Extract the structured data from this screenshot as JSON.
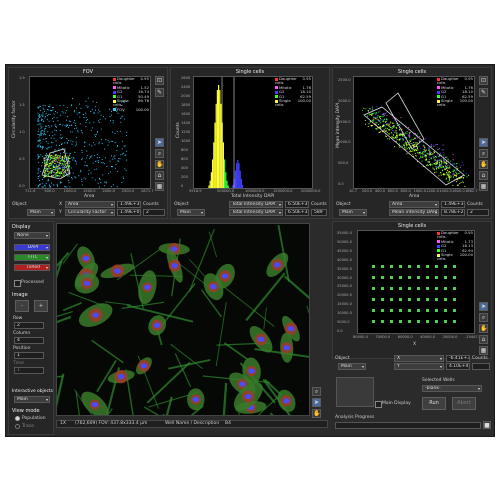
{
  "plots": {
    "fov": {
      "title": "FOV",
      "xlabel": "Area",
      "ylabel": "Circularity factor",
      "xticks": [
        "711.4",
        "500.0",
        "1000.0",
        "1500.0",
        "2000.0",
        "2500.0",
        "2871.7"
      ],
      "yticks": [
        "1.9",
        "1.5",
        "1.0",
        "0.5",
        "0.0"
      ],
      "legend": [
        {
          "name": "Daughter cells",
          "value": "0.95",
          "color": "#ff3030"
        },
        {
          "name": "Mitotic",
          "value": "1.52",
          "color": "#ff55ff"
        },
        {
          "name": "G2",
          "value": "16.74",
          "color": "#3f3fff"
        },
        {
          "name": "G1",
          "value": "50.49",
          "color": "#30ff30"
        },
        {
          "name": "Single cells",
          "value": "89.76",
          "color": "#ffff30"
        },
        {
          "name": "FOV",
          "value": "100.00",
          "color": "#30d0ff"
        }
      ],
      "x_box_label": "X",
      "y_box_label": "Y",
      "x_param": "Area",
      "y_param": "Circularity Factor",
      "x_val": "1.49E+3",
      "y_val": "1.49E+0",
      "counts_label": "Counts",
      "counts": "2",
      "object_label": "Object",
      "object": "Main"
    },
    "hist": {
      "title": "Single cells",
      "xlabel": "Total Intensity DAPI",
      "ylabel": "Counts",
      "xticks": [
        "5918.9",
        "500000.0",
        "1000000.0",
        "1500000.0",
        "2000000.0"
      ],
      "yticks": [
        "2600",
        "2400",
        "2000",
        "1800",
        "1600",
        "1400",
        "1200",
        "1000",
        "800",
        "600",
        "400",
        "200",
        "0"
      ],
      "legend": [
        {
          "name": "Daughter cells",
          "value": "0.95",
          "color": "#ff3030"
        },
        {
          "name": "Mitotic",
          "value": "1.76",
          "color": "#ff55ff"
        },
        {
          "name": "G2",
          "value": "18.10",
          "color": "#3f3fff"
        },
        {
          "name": "G1",
          "value": "62.59",
          "color": "#30ff30"
        },
        {
          "name": "Single cells",
          "value": "100.00",
          "color": "#ffff30"
        }
      ],
      "x_param": "Total Intensity DAPI",
      "y_param": "Total Intensity DAPI",
      "x_val": "6.50E+3",
      "y_val": "6.50E+3",
      "counts_label": "Counts",
      "counts": "589",
      "object": "Main"
    },
    "scatter2": {
      "title": "Single cells",
      "xlabel": "Area",
      "ylabel": "Mean intensity DAPI",
      "xticks": [
        "10.7",
        "200.0",
        "400.0",
        "600.0",
        "800.0",
        "1000.0",
        "1200.0",
        "1400.0",
        "1600.0",
        "1862.7"
      ],
      "yticks": [
        "2500.0",
        "2000.0",
        "1500.0",
        "1000.0",
        "500.0",
        "0.0"
      ],
      "legend": [
        {
          "name": "Daughter cells",
          "value": "0.95",
          "color": "#ff3030"
        },
        {
          "name": "Mitotic",
          "value": "1.76",
          "color": "#ff55ff"
        },
        {
          "name": "G2",
          "value": "18.10",
          "color": "#3f3fff"
        },
        {
          "name": "G1",
          "value": "62.59",
          "color": "#30ff30"
        },
        {
          "name": "Single cells",
          "value": "100.00",
          "color": "#ffff30"
        }
      ],
      "x_param": "Area",
      "y_param": "Mean intensity DAPI",
      "x_val": "1.49E+3",
      "y_val": "8.78E+2",
      "counts_label": "Counts",
      "counts": "2",
      "object": "Main"
    },
    "plate": {
      "title": "Single cells",
      "xlabel": "X",
      "yticks": [
        "55000.0",
        "50000.0",
        "45000.0",
        "40000.0",
        "35000.0",
        "30000.0",
        "25000.0",
        "20000.0",
        "15000.0",
        "10000.0",
        "5000.0",
        "0.0"
      ],
      "xticks": [
        "80000.0",
        "70000.0",
        "60000.0",
        "40000.0",
        "20000.0",
        "-15447.0"
      ],
      "legend": [
        {
          "name": "Daughter cells",
          "value": "0.95",
          "color": "#ff3030"
        },
        {
          "name": "Mitotic",
          "value": "1.73",
          "color": "#ff55ff"
        },
        {
          "name": "G2",
          "value": "18.13",
          "color": "#3f3fff"
        },
        {
          "name": "G1",
          "value": "62.94",
          "color": "#30ff30"
        },
        {
          "name": "Single cells",
          "value": "100.00",
          "color": "#ffff30"
        }
      ],
      "x_param": "X",
      "y_param": "Y",
      "x_val": "-6.41E+3",
      "y_val": "4.10E+4",
      "counts_label": "Counts",
      "object_label": "Object",
      "object": "Main"
    }
  },
  "display": {
    "header": "Display",
    "mode": "None",
    "channels": [
      {
        "name": "DAPI",
        "color": "#3a3ad0"
      },
      {
        "name": "FITC",
        "color": "#2a8a2a"
      },
      {
        "name": "TxRed",
        "color": "#b02020"
      }
    ],
    "processed_label": "Processed"
  },
  "image": {
    "header": "Image",
    "minus": "-",
    "plus": "+",
    "row_label": "Row",
    "row_value": "2",
    "column_label": "Column",
    "column_value": "4",
    "position_label": "Position",
    "position_value": "1",
    "time_label": "Time",
    "time_value": "1"
  },
  "interactive": {
    "header": "Interactive objects",
    "value": "Main"
  },
  "view_mode": {
    "header": "View mode",
    "population": "Population",
    "trace": "Trace"
  },
  "statusbar": {
    "prefix": "1X",
    "coords": "(762,609) FOV: 437.8x333.4 µm",
    "well_label": "Well Name / Description",
    "well": "B4"
  },
  "wells": {
    "main_display": "Main Display",
    "selected_label": "Selected Wells",
    "selected": "-blank-",
    "run": "Run",
    "stop": "Abort"
  },
  "progress": {
    "label": "Analysis Progress",
    "value": 0
  }
}
